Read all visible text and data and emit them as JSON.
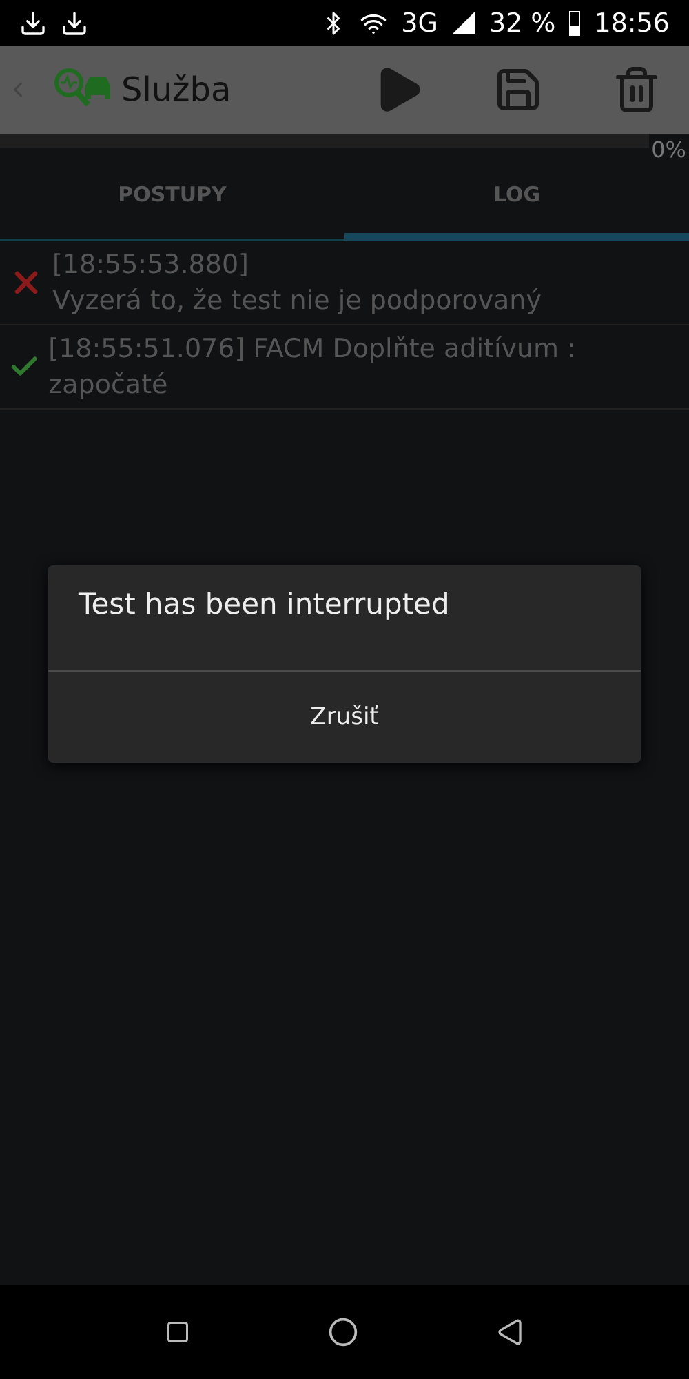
{
  "status_bar": {
    "battery": "32 %",
    "network": "3G",
    "time": "18:56"
  },
  "app_bar": {
    "title": "Služba"
  },
  "progress": {
    "level": 0,
    "reading": "0%"
  },
  "tabs": [
    {
      "label": "POSTUPY",
      "selected": false
    },
    {
      "label": "LOG",
      "selected": true
    }
  ],
  "log": [
    {
      "kind": "error",
      "lines": [
        "[18:55:53.880]",
        "Vyzerá to, že test nie je podporovaný"
      ]
    },
    {
      "kind": "success",
      "lines": [
        "[18:55:51.076] FACM Doplňte aditívum : započaté"
      ]
    }
  ],
  "dialog": {
    "message": "Test has been interrupted",
    "buttons": [
      "Zrušiť"
    ]
  }
}
